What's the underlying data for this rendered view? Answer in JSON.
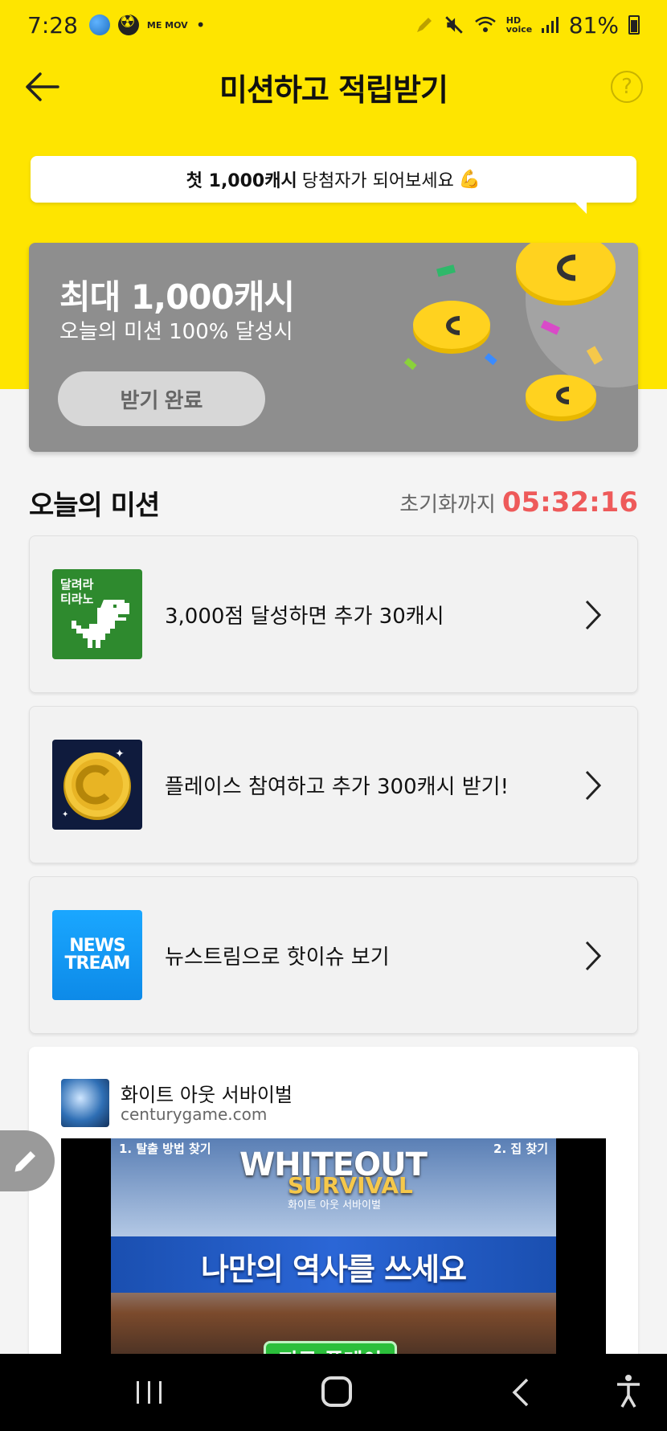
{
  "status_bar": {
    "time": "7:28",
    "memo_label": "ME MOV",
    "network": "HD voice",
    "battery": "81%"
  },
  "header": {
    "title": "미션하고 적립받기",
    "help_label": "?"
  },
  "banner": {
    "bubble_bold": "첫 1,000캐시",
    "bubble_rest": "당첨자가 되어보세요",
    "bubble_emoji": "💪"
  },
  "promo": {
    "title": "최대 1,000캐시",
    "subtitle": "오늘의 미션 100% 달성시",
    "button_label": "받기 완료"
  },
  "missions": {
    "title": "오늘의 미션",
    "reset_label": "초기화까지",
    "reset_time": "05:32:16",
    "items": [
      {
        "thumb_text_1": "달려라",
        "thumb_text_2": "티라노",
        "label": "3,000점 달성하면 추가 30캐시"
      },
      {
        "label": "플레이스 참여하고 추가 300캐시 받기!"
      },
      {
        "thumb_text_1": "NEWS",
        "thumb_text_2": "TREAM",
        "label": "뉴스트림으로 핫이슈 보기"
      }
    ]
  },
  "ad": {
    "name": "화이트 아웃 서바이벌",
    "domain": "centurygame.com",
    "step1": "1. 탈출 방법 찾기",
    "step2": "2. 집 찾기",
    "brand_line1": "WHITEOUT",
    "brand_line2": "SURVIVAL",
    "brand_line3": "화이트 아웃 서바이벌",
    "slogan": "나만의 역사를 쓰세요",
    "cta": "지금 플레이"
  },
  "colors": {
    "brand_yellow": "#fee500",
    "timer_red": "#ee5a5a",
    "card_gray": "#8e8e8e"
  }
}
